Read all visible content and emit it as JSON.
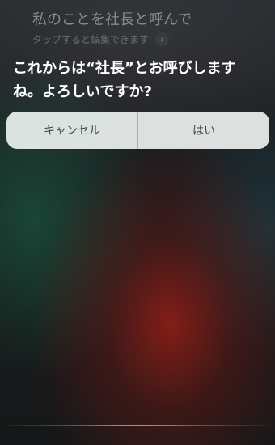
{
  "query": {
    "text": "私のことを社長と呼んで",
    "edit_hint": "タップすると編集できます",
    "edit_icon": "chevron-right-icon"
  },
  "response": {
    "text": "これからは“社長”とお呼びしますね。よろしいですか?"
  },
  "buttons": {
    "cancel_label": "キャンセル",
    "confirm_label": "はい"
  },
  "colors": {
    "button_bg": "#EBF0EE",
    "button_text": "#3C4A48",
    "response_text": "#FFFFFF",
    "query_text": "#8A8C90",
    "wave": "#4FA8FF"
  }
}
